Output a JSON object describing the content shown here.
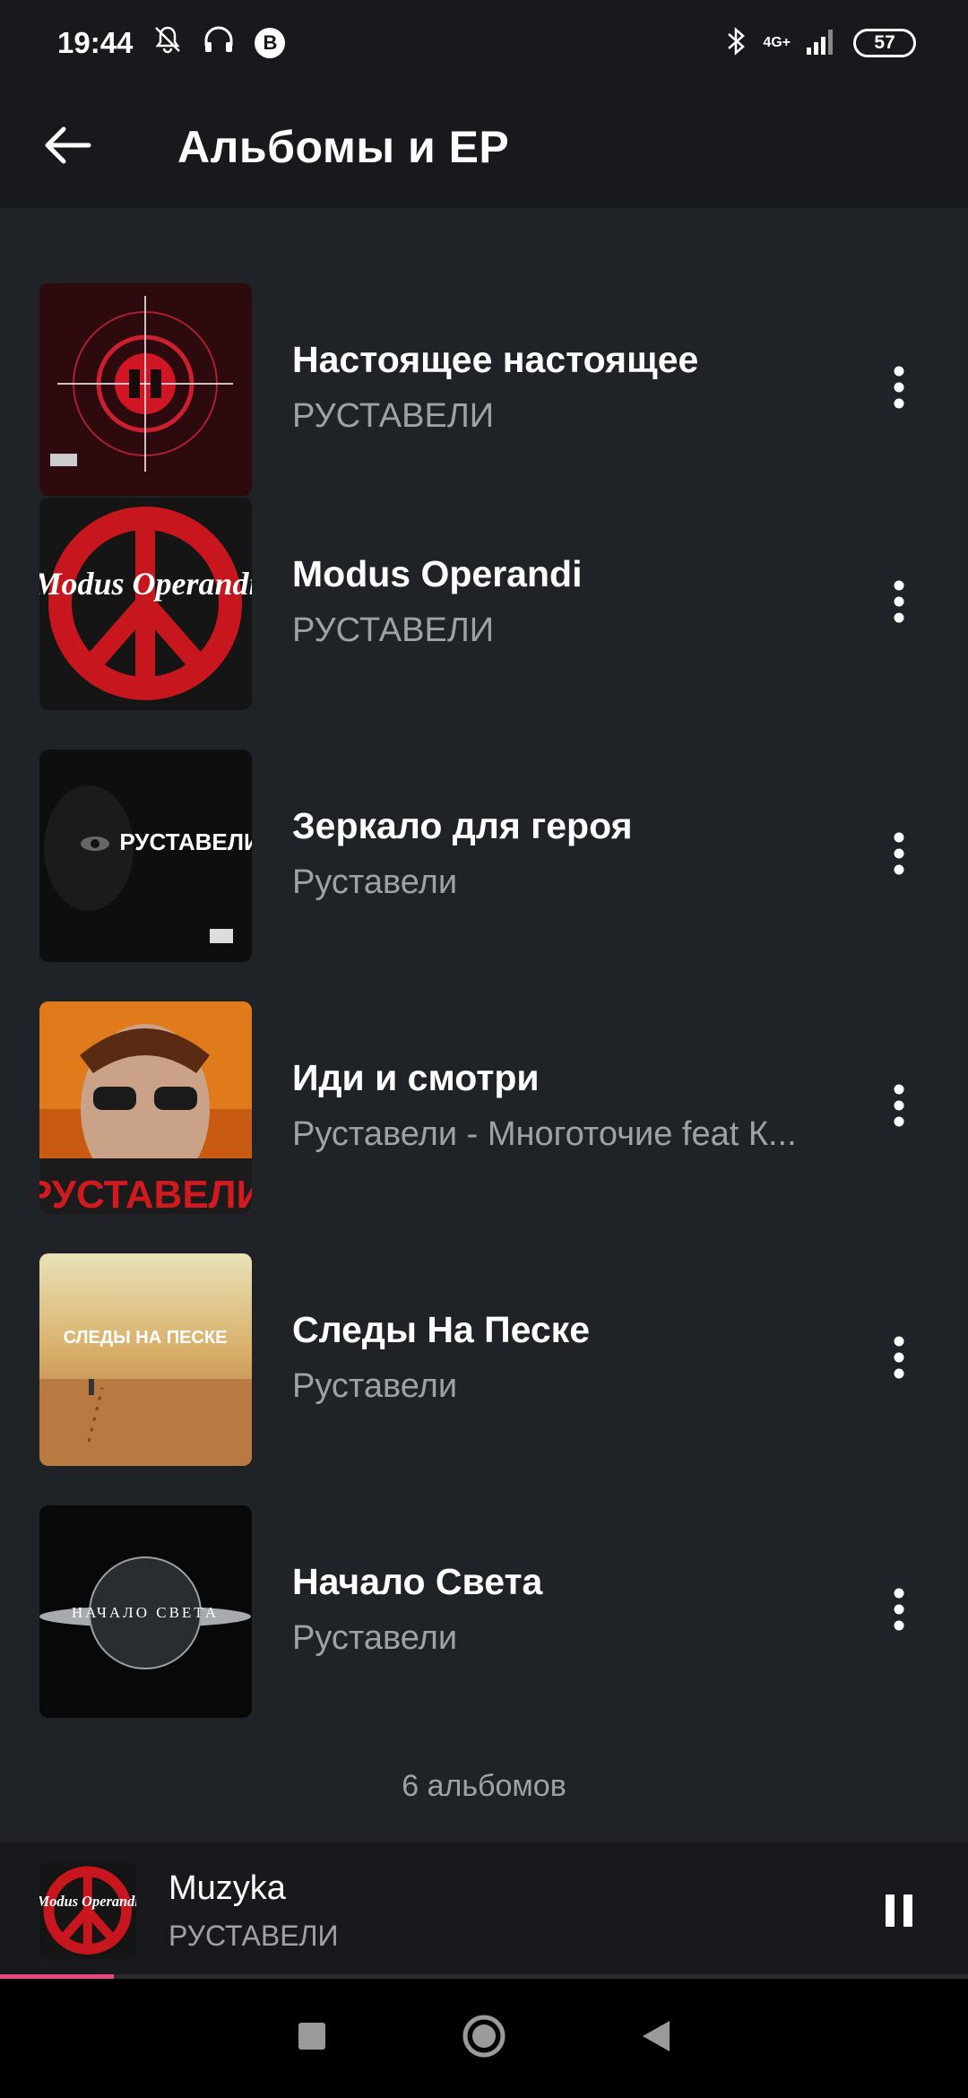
{
  "status": {
    "time": "19:44",
    "vk": "B",
    "network": "4G+",
    "battery": "57",
    "icons": [
      "bell-off-icon",
      "headphones-icon",
      "vk-icon",
      "bluetooth-icon",
      "signal-icon",
      "battery-icon"
    ]
  },
  "appbar": {
    "title": "Альбомы и EP",
    "back_icon": "arrow-left-icon"
  },
  "albums": [
    {
      "title": "Настоящее настоящее",
      "artist": "РУСТАВЕЛИ",
      "cover": "red-target-cover"
    },
    {
      "title": "Modus Operandi",
      "artist": "РУСТАВЕЛИ",
      "cover": "modus-operandi-cover",
      "cover_text": "Modus Operandi"
    },
    {
      "title": "Зеркало для героя",
      "artist": "Руставели",
      "cover": "dark-eye-cover",
      "cover_text": "РУСТАВЕЛИ"
    },
    {
      "title": "Иди и смотри",
      "artist": "Руставели - Многоточие feat К...",
      "cover": "portrait-cover",
      "cover_text": "РУСТАВЕЛИ"
    },
    {
      "title": "Следы На Песке",
      "artist": "Руставели",
      "cover": "beach-cover",
      "cover_text": "СЛЕДЫ НА ПЕСКЕ"
    },
    {
      "title": "Начало Света",
      "artist": "Руставели",
      "cover": "planet-cover",
      "cover_text": "НАЧАЛО СВЕТА"
    }
  ],
  "footer": {
    "count_label": "6 альбомов"
  },
  "player": {
    "title": "Muzyka",
    "artist": "РУСТАВЕЛИ",
    "cover_text": "Modus Operandi",
    "progress": 0.118,
    "accent": "#e8477a"
  },
  "colors": {
    "background": "#1f2227",
    "bar": "#17191c",
    "secondary_text": "#9ea1a6"
  }
}
